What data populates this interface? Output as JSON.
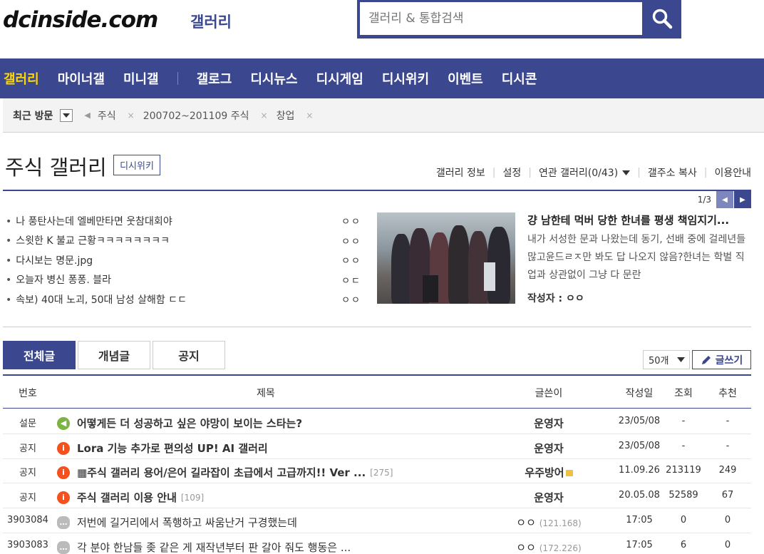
{
  "header": {
    "logo": "dcinside.com",
    "logo_sub": "갤러리",
    "search_placeholder": "갤러리 & 통합검색"
  },
  "nav": {
    "items": [
      "갤러리",
      "마이너갤",
      "미니갤",
      "갤로그",
      "디시뉴스",
      "디시게임",
      "디시위키",
      "이벤트",
      "디시콘"
    ]
  },
  "recent": {
    "label": "최근 방문",
    "tags": [
      "주식",
      "200702~201109 주식",
      "창업"
    ]
  },
  "gallery": {
    "title": "주식 갤러리",
    "wiki_label": "디시위키",
    "tools": [
      "갤러리 정보",
      "설정",
      "연관 갤러리(0/43)",
      "갤주소 복사",
      "이용안내"
    ]
  },
  "featured": {
    "page": "1/3",
    "list": [
      {
        "title": "나 풍탄사는데 엘베만타면 웃참대회야",
        "author": "ㅇㅇ"
      },
      {
        "title": "스윗한 K 불교 근황ㅋㅋㅋㅋㅋㅋㅋㅋ",
        "author": "ㅇㅇ"
      },
      {
        "title": "다시보는 명문.jpg",
        "author": "ㅇㅇ"
      },
      {
        "title": "오늘자 병신 퐁퐁. 블라",
        "author": "ㅇㄷ"
      },
      {
        "title": "속보) 40대 노괴, 50대 남성 살해함 ㄷㄷ",
        "author": "ㅇㅇ"
      }
    ],
    "main_title": "걍 남한테 먹버 당한 한녀를 평생 책임지기...",
    "main_body": "내가 서성한 문과 나왔는데 동기, 선배 중에 걸레년들 많고윤드ㄹㅈ만 봐도 답 나오지 않음?한녀는 학벌 직업과 상관없이 그냥 다 문란",
    "main_author": "작성자 : ㅇㅇ"
  },
  "tabs": [
    "전체글",
    "개념글",
    "공지"
  ],
  "list_controls": {
    "count": "50개",
    "write": "글쓰기"
  },
  "table": {
    "headers": [
      "번호",
      "제목",
      "글쓴이",
      "작성일",
      "조회",
      "추천"
    ],
    "rows": [
      {
        "num": "설문",
        "icon": "survey",
        "title": "어떻게든 더 성공하고 싶은 야망이 보이는 스타는?",
        "reply": "",
        "writer": "운영자",
        "ip": "",
        "date": "23/05/08",
        "views": "-",
        "rec": "-"
      },
      {
        "num": "공지",
        "icon": "notice",
        "title": "Lora 기능 추가로 편의성 UP! AI 갤러리",
        "reply": "",
        "writer": "운영자",
        "ip": "",
        "date": "23/05/08",
        "views": "-",
        "rec": "-"
      },
      {
        "num": "공지",
        "icon": "notice",
        "title": "▦주식 갤러리 용어/은어 길라잡이 초급에서 고급까지!! Ver ...",
        "reply": "[275]",
        "writer": "우주방어",
        "ip": "",
        "date": "11.09.26",
        "views": "213119",
        "rec": "249"
      },
      {
        "num": "공지",
        "icon": "notice",
        "title": "주식 갤러리 이용 안내",
        "reply": "[109]",
        "writer": "운영자",
        "ip": "",
        "date": "20.05.08",
        "views": "52589",
        "rec": "67"
      },
      {
        "num": "3903084",
        "icon": "talk",
        "title": "저번에 길거리에서 폭행하고 싸움난거 구경했는데",
        "reply": "",
        "writer": "ㅇㅇ",
        "ip": "(121.168)",
        "date": "17:05",
        "views": "0",
        "rec": "0"
      },
      {
        "num": "3903083",
        "icon": "talk",
        "title": "각 분야 한남들 좆 같은 게 재작년부터 판 갈아 줘도 행동은 ...",
        "reply": "",
        "writer": "ㅇㅇ",
        "ip": "(172.226)",
        "date": "17:05",
        "views": "6",
        "rec": "0"
      }
    ]
  },
  "colors": {
    "brand": "#3b4890",
    "nav_active": "#ffd800",
    "notice_icon": "#f4511e",
    "survey_icon": "#7cb342"
  }
}
